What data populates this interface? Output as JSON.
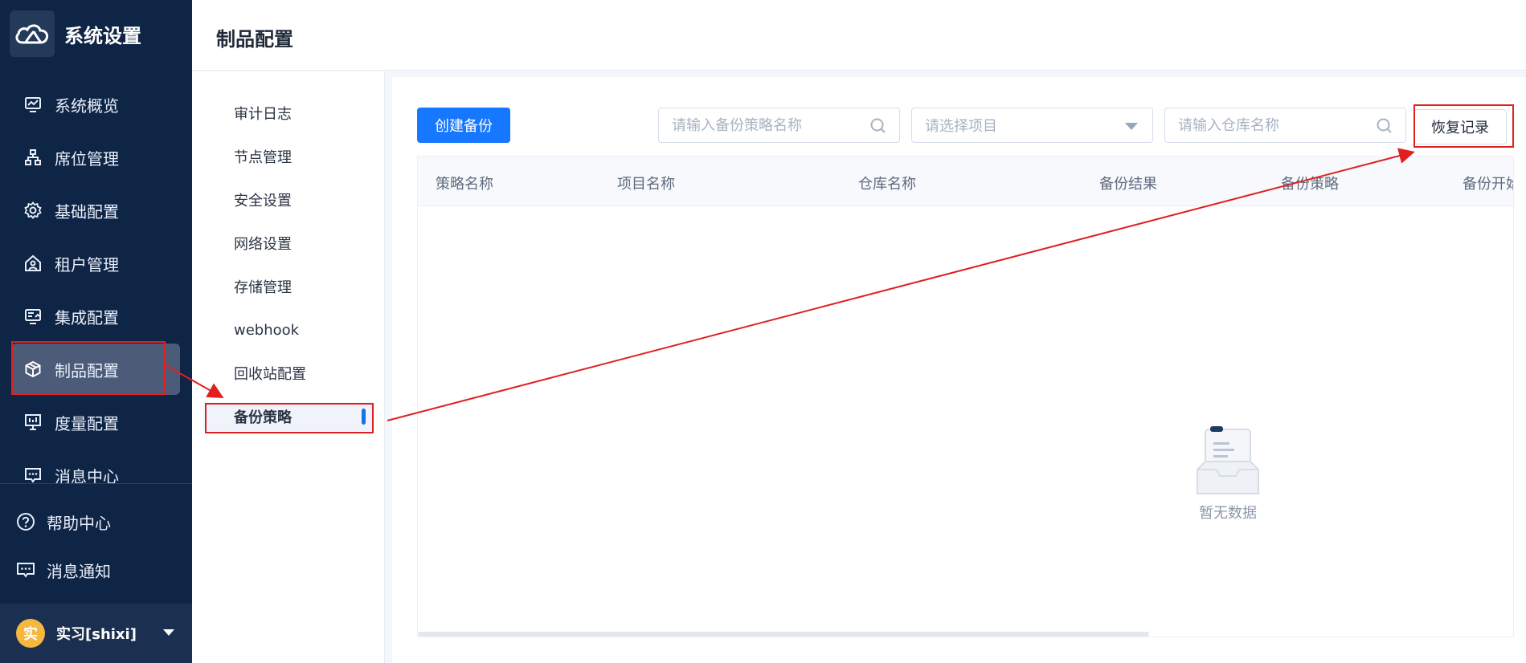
{
  "sidebar": {
    "brand_title": "系统设置",
    "items": [
      {
        "label": "系统概览",
        "icon": "monitor-chart-icon"
      },
      {
        "label": "席位管理",
        "icon": "org-chart-icon"
      },
      {
        "label": "基础配置",
        "icon": "gear-icon"
      },
      {
        "label": "租户管理",
        "icon": "house-user-icon"
      },
      {
        "label": "集成配置",
        "icon": "integration-screen-icon"
      },
      {
        "label": "制品配置",
        "icon": "package-box-icon"
      },
      {
        "label": "度量配置",
        "icon": "dashboard-board-icon"
      },
      {
        "label": "消息中心",
        "icon": "message-icon"
      }
    ],
    "active_index": 5,
    "bottom": [
      {
        "label": "帮助中心",
        "icon": "help-circle-icon"
      },
      {
        "label": "消息通知",
        "icon": "notification-message-icon"
      }
    ],
    "user": {
      "avatar_text": "实",
      "name": "实习[shixi]"
    }
  },
  "header": {
    "title": "制品配置"
  },
  "submenu": {
    "items": [
      "审计日志",
      "节点管理",
      "安全设置",
      "网络设置",
      "存储管理",
      "webhook",
      "回收站配置",
      "备份策略"
    ],
    "active_index": 7
  },
  "toolbar": {
    "create_label": "创建备份",
    "policy_search_placeholder": "请输入备份策略名称",
    "project_select_placeholder": "请选择项目",
    "repo_search_placeholder": "请输入仓库名称",
    "restore_label": "恢复记录"
  },
  "table": {
    "columns": [
      "策略名称",
      "项目名称",
      "仓库名称",
      "备份结果",
      "备份策略",
      "备份开始"
    ],
    "empty_text": "暂无数据"
  },
  "colors": {
    "sidebar_bg": "#0f2545",
    "primary": "#1677ff",
    "annotation": "#e02020"
  }
}
